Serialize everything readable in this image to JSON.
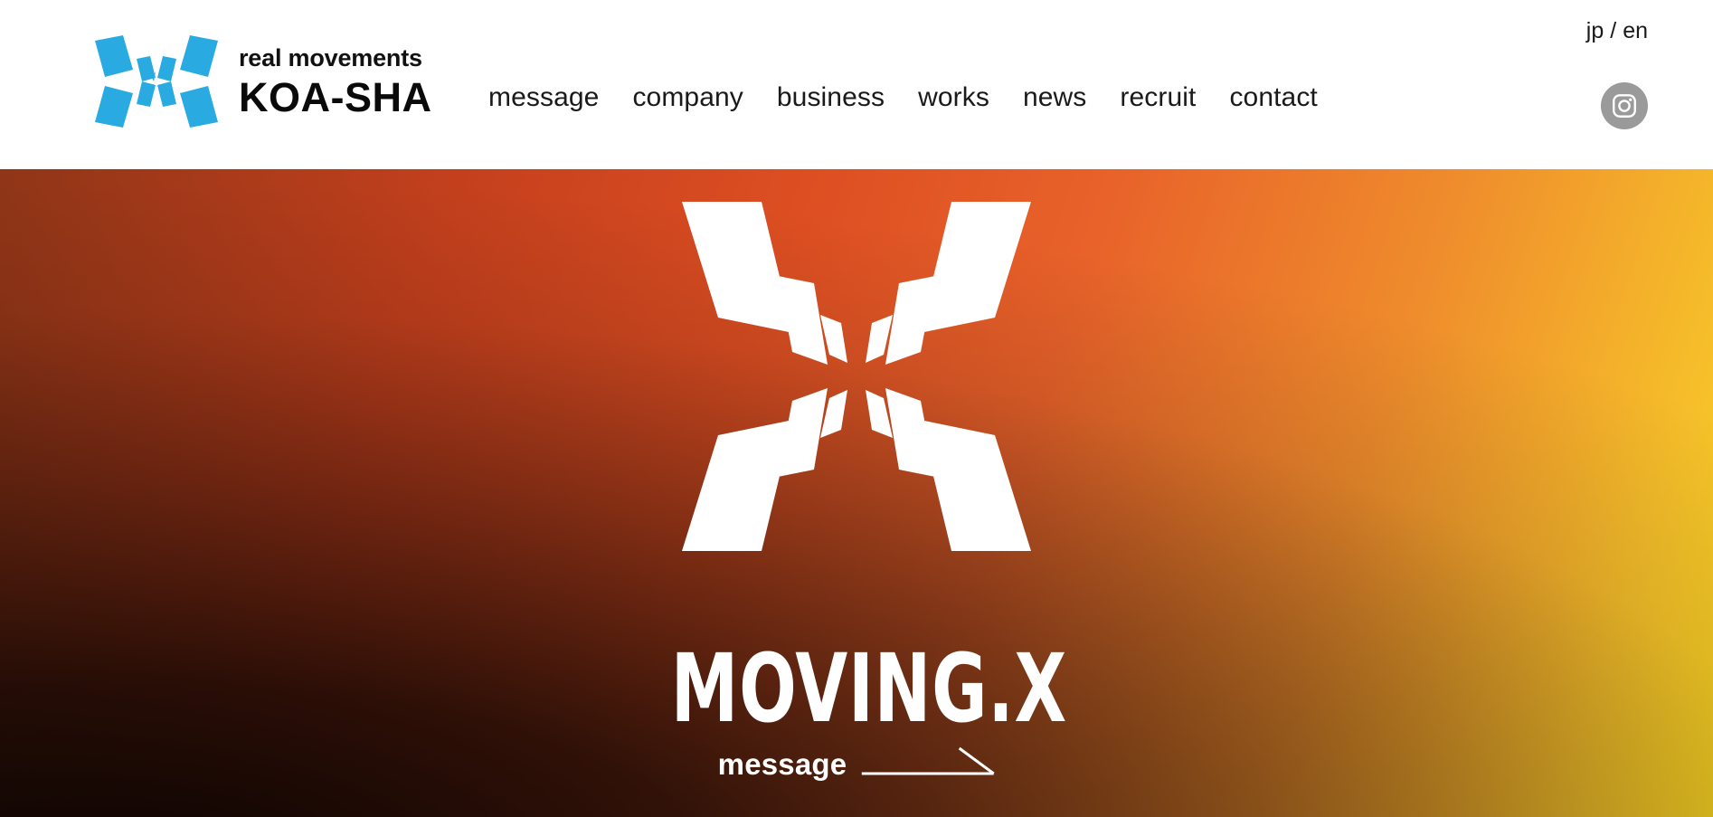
{
  "header": {
    "brand": {
      "tagline": "real movements",
      "name": "KOA-SHA",
      "mark_icon": "koasha-x-logo-icon",
      "mark_color": "#29abe2"
    },
    "nav": [
      {
        "label": "message"
      },
      {
        "label": "company"
      },
      {
        "label": "business"
      },
      {
        "label": "works"
      },
      {
        "label": "news"
      },
      {
        "label": "recruit"
      },
      {
        "label": "contact"
      }
    ],
    "lang": {
      "jp": "jp",
      "separator": "/",
      "en": "en"
    },
    "social": {
      "instagram_icon": "instagram-icon",
      "circle_color": "#9a9a9a"
    }
  },
  "hero": {
    "mark_icon": "moving-x-logo-icon",
    "mark_color": "#ffffff",
    "title": "MOVING.X",
    "cta": {
      "label": "message",
      "arrow_icon": "arrow-right-icon"
    },
    "gradient": {
      "top_left": "#7d2a13",
      "top_right": "#f9d423",
      "bottom_left": "#180800",
      "bottom_right": "#ef8c2c",
      "center": "#e0601f"
    }
  }
}
